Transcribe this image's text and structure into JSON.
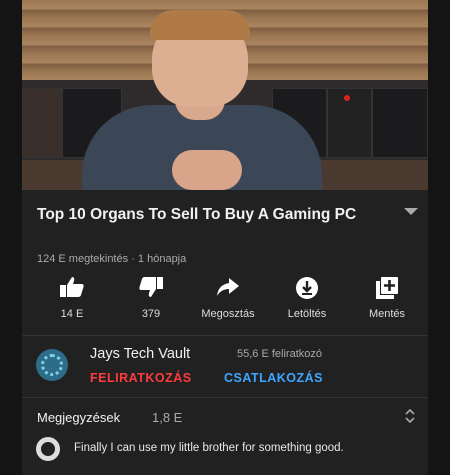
{
  "video": {
    "title": "Top 10 Organs To Sell To Buy A Gaming PC",
    "views": "124 E megtekintés",
    "separator": "·",
    "age": "1 hónapja"
  },
  "actions": [
    {
      "label": "14 E",
      "icon": "thumbs-up-icon"
    },
    {
      "label": "379",
      "icon": "thumbs-down-icon"
    },
    {
      "label": "Megosztás",
      "icon": "share-icon"
    },
    {
      "label": "Letöltés",
      "icon": "download-icon"
    },
    {
      "label": "Mentés",
      "icon": "add-to-playlist-icon"
    }
  ],
  "channel": {
    "name": "Jays Tech Vault",
    "subscribers": "55,6 E feliratkozó",
    "subscribe_label": "FELIRATKOZÁS",
    "join_label": "CSATLAKOZÁS"
  },
  "comments": {
    "header": "Megjegyzések",
    "count": "1,8 E",
    "top_comment": "Finally I can use my little brother for something good."
  },
  "colors": {
    "background": "#212121",
    "subscribe": "#ff3b3b",
    "join": "#3ea6ff",
    "secondary_text": "#aaaaaa"
  }
}
